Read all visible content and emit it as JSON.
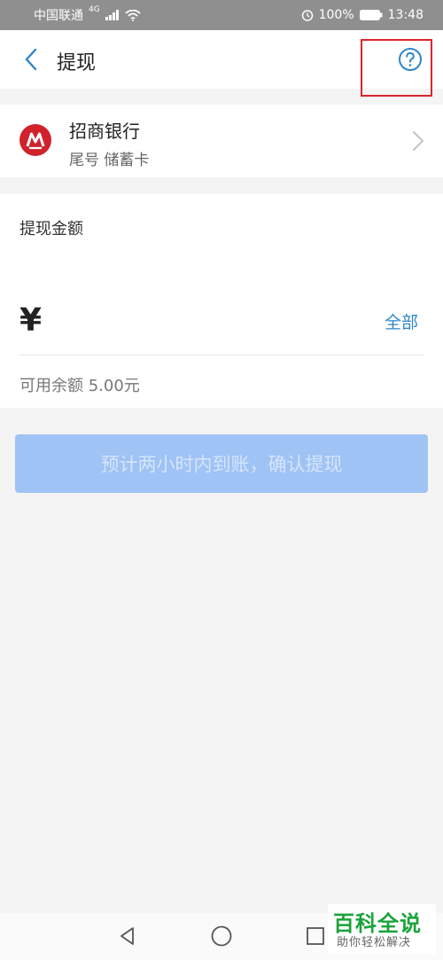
{
  "status_bar": {
    "carrier": "中国联通",
    "signal_tag": "4G",
    "battery": "100%",
    "time": "13:48"
  },
  "header": {
    "title": "提现"
  },
  "bank": {
    "name": "招商银行",
    "card_info": "尾号 储蓄卡"
  },
  "amount": {
    "label": "提现金额",
    "currency": "¥",
    "value": "",
    "all_label": "全部",
    "balance": "可用余额 5.00元"
  },
  "confirm": {
    "label": "预计两小时内到账，确认提现"
  },
  "watermark": {
    "title": "百科全说",
    "subtitle": "助你轻松解决"
  },
  "colors": {
    "accent": "#2f86c9",
    "button_disabled": "#9fc3f5",
    "bank_red": "#d0222c",
    "highlight": "#d9262c"
  }
}
